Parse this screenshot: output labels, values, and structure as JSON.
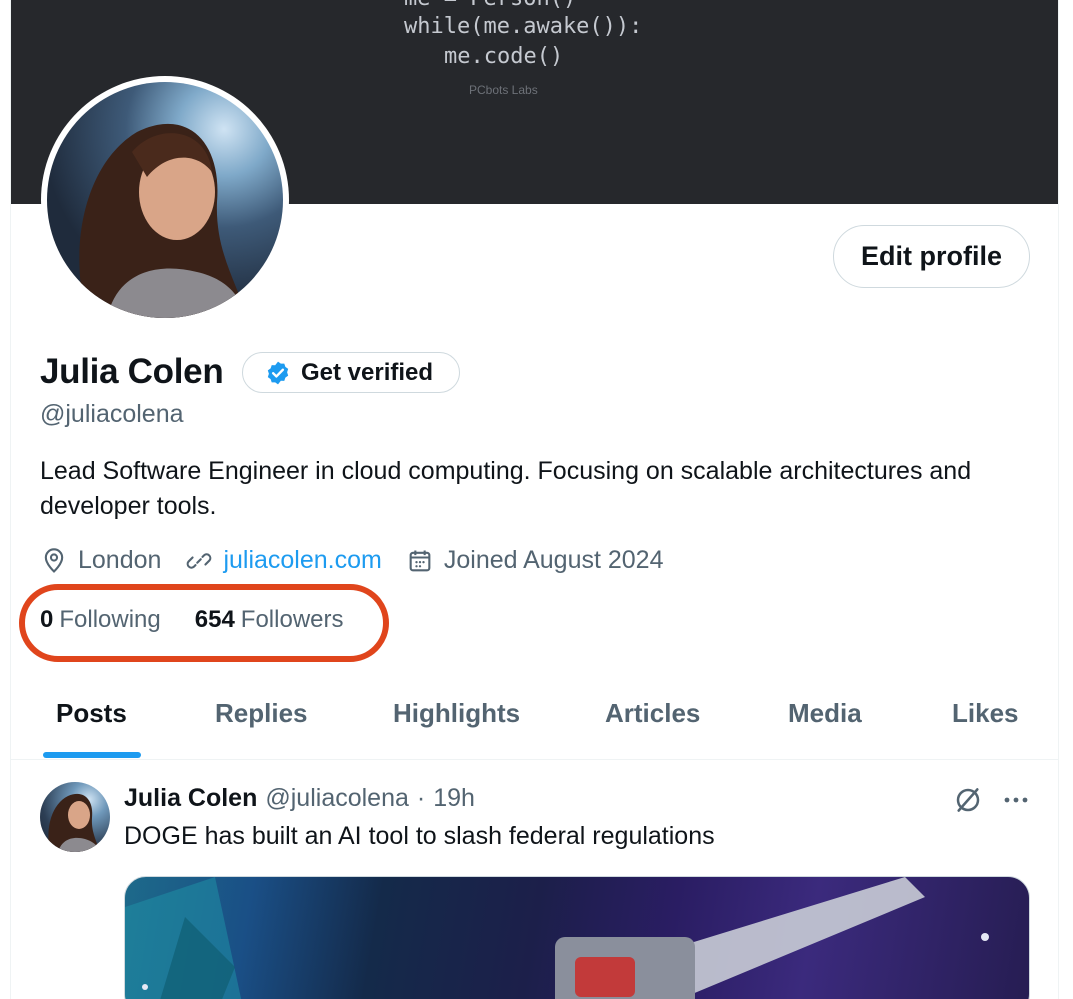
{
  "banner": {
    "code_lines": [
      "me = Person()",
      "while(me.awake()):",
      "me.code()"
    ],
    "brand": "PCbots Labs"
  },
  "profile": {
    "name": "Julia Colen",
    "get_verified": "Get verified",
    "handle": "@juliacolena",
    "bio": "Lead Software Engineer in cloud computing. Focusing on scalable architectures and developer tools.",
    "location": "London",
    "website": "juliacolen.com",
    "joined": "Joined August 2024",
    "following_count": "0",
    "following_label": "Following",
    "followers_count": "654",
    "followers_label": "Followers",
    "edit_profile": "Edit profile"
  },
  "tabs": [
    {
      "label": "Posts",
      "active": true
    },
    {
      "label": "Replies"
    },
    {
      "label": "Highlights"
    },
    {
      "label": "Articles"
    },
    {
      "label": "Media"
    },
    {
      "label": "Likes"
    }
  ],
  "post": {
    "author": "Julia Colen",
    "handle": "@juliacolena",
    "separator": "·",
    "time": "19h",
    "text": "DOGE has built an AI tool to slash federal regulations"
  },
  "colors": {
    "accent": "#1d9bf0",
    "highlight_ring": "#e0451c",
    "banner": "#26282c"
  },
  "icons": [
    "location-icon",
    "link-icon",
    "calendar-icon",
    "verified-badge-icon",
    "grok-icon",
    "more-icon"
  ]
}
